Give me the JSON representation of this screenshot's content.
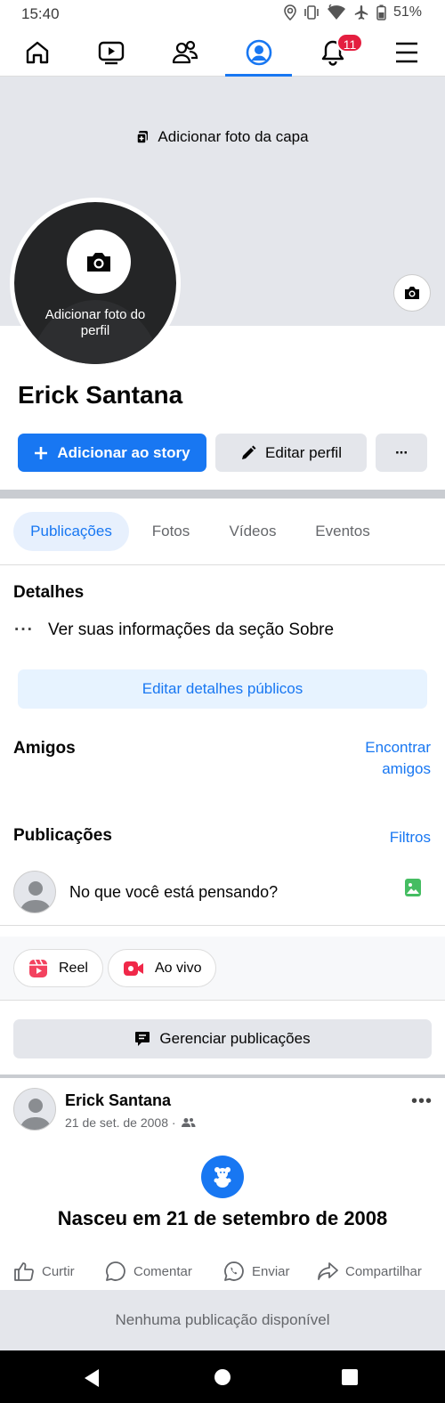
{
  "status_bar": {
    "time": "15:40",
    "battery": "51%"
  },
  "nav": {
    "notifications_badge": "11",
    "active_tab": "profile"
  },
  "cover": {
    "add_cover_label": "Adicionar foto da capa"
  },
  "avatar": {
    "add_photo_label": "Adicionar foto do perfil"
  },
  "profile": {
    "name": "Erick Santana"
  },
  "actions": {
    "add_story": "Adicionar ao story",
    "edit_profile": "Editar perfil",
    "more": "···"
  },
  "tabs": [
    "Publicações",
    "Fotos",
    "Vídeos",
    "Eventos"
  ],
  "details": {
    "title": "Detalhes",
    "about_link": "Ver suas informações da seção Sobre",
    "edit_public": "Editar detalhes públicos"
  },
  "friends": {
    "title": "Amigos",
    "find": "Encontrar amigos"
  },
  "posts": {
    "title": "Publicações",
    "filters": "Filtros",
    "composer_placeholder": "No que você está pensando?",
    "reel": "Reel",
    "live": "Ao vivo",
    "manage": "Gerenciar publicações"
  },
  "post": {
    "author": "Erick Santana",
    "date": "21 de set. de 2008 ·",
    "life_event": "Nasceu em 21 de setembro de 2008",
    "like": "Curtir",
    "comment": "Comentar",
    "send": "Enviar",
    "share": "Compartilhar"
  },
  "empty_state": "Nenhuma publicação disponível",
  "colors": {
    "accent": "#1877f2",
    "badge": "#e41e3f",
    "surface": "#e4e6eb"
  }
}
